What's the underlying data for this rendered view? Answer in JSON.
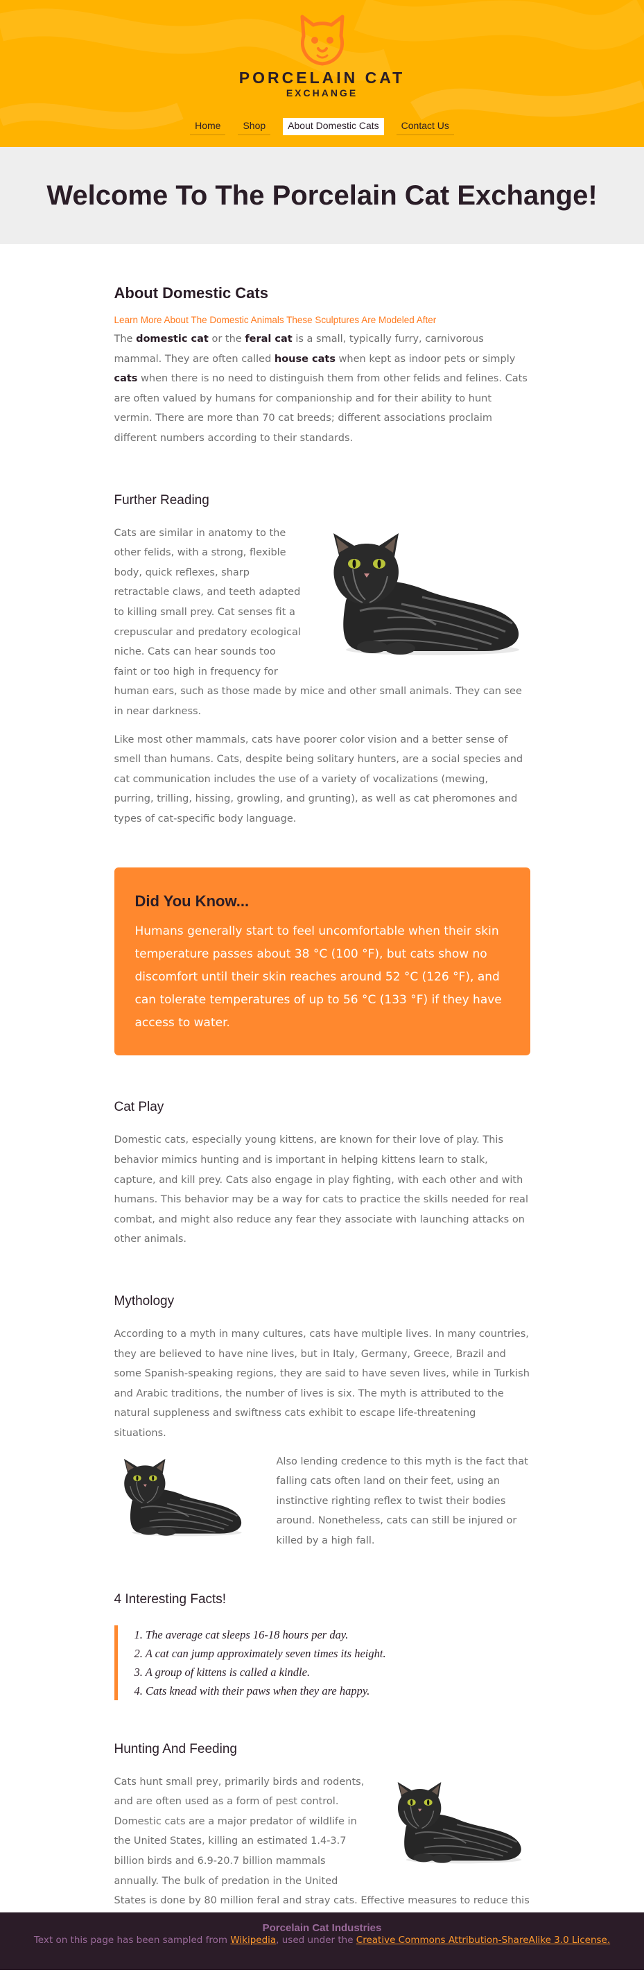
{
  "header": {
    "brand_line1": "PORCELAIN CAT",
    "brand_line2": "EXCHANGE",
    "logo_icon": "cat-face-icon",
    "nav": [
      {
        "label": "Home"
      },
      {
        "label": "Shop"
      },
      {
        "label": "About Domestic Cats",
        "active": true
      },
      {
        "label": "Contact Us"
      }
    ]
  },
  "hero": {
    "title": "Welcome To The Porcelain Cat Exchange!"
  },
  "about": {
    "title": "About Domestic Cats",
    "subtitle": "Learn More About The Domestic Animals These Sculptures Are Modeled After",
    "p1_a": "The ",
    "p1_b1": "domestic cat",
    "p1_c": " or the ",
    "p1_b2": "feral cat",
    "p1_d": " is a small, typically furry, carnivorous mammal. They are often called ",
    "p1_b3": "house cats",
    "p1_e": " when kept as indoor pets or simply ",
    "p1_b4": "cats",
    "p1_f": " when there is no need to distinguish them from other felids and felines. Cats are often valued by humans for companionship and for their ability to hunt vermin. There are more than 70 cat breeds; different associations proclaim different numbers according to their standards."
  },
  "further": {
    "title": "Further Reading",
    "p1": "Cats are similar in anatomy to the other felids, with a strong, flexible body, quick reflexes, sharp retractable claws, and teeth adapted to killing small prey. Cat senses fit a crepuscular and predatory ecological niche. Cats can hear sounds too faint or too high in frequency for human ears, such as those made by mice and other small animals. They can see in near darkness.",
    "p2": "Like most other mammals, cats have poorer color vision and a better sense of smell than humans. Cats, despite being solitary hunters, are a social species and cat communication includes the use of a variety of vocalizations (mewing, purring, trilling, hissing, growling, and grunting), as well as cat pheromones and types of cat-specific body language."
  },
  "did_you_know": {
    "title": "Did You Know...",
    "text": "Humans generally start to feel uncomfortable when their skin temperature passes about 38 °C (100 °F), but cats show no discomfort until their skin reaches around 52 °C (126 °F), and can tolerate temperatures of up to 56 °C (133 °F) if they have access to water."
  },
  "play": {
    "title": "Cat Play",
    "p1": "Domestic cats, especially young kittens, are known for their love of play. This behavior mimics hunting and is important in helping kittens learn to stalk, capture, and kill prey. Cats also engage in play fighting, with each other and with humans. This behavior may be a way for cats to practice the skills needed for real combat, and might also reduce any fear they associate with launching attacks on other animals."
  },
  "mythology": {
    "title": "Mythology",
    "p1": "According to a myth in many cultures, cats have multiple lives. In many countries, they are believed to have nine lives, but in Italy, Germany, Greece, Brazil and some Spanish-speaking regions, they are said to have seven lives, while in Turkish and Arabic traditions, the number of lives is six. The myth is attributed to the natural suppleness and swiftness cats exhibit to escape life-threatening situations.",
    "p2": "Also lending credence to this myth is the fact that falling cats often land on their feet, using an instinctive righting reflex to twist their bodies around. Nonetheless, cats can still be injured or killed by a high fall."
  },
  "facts": {
    "title": "4 Interesting Facts!",
    "items": [
      "1. The average cat sleeps 16-18 hours per day.",
      "2. A cat can jump approximately seven times its height.",
      "3. A group of kittens is called a kindle.",
      "4. Cats knead with their paws when they are happy."
    ]
  },
  "hunting": {
    "title": "Hunting And Feeding",
    "p1": "Cats hunt small prey, primarily birds and rodents, and are often used as a form of pest control. Domestic cats are a major predator of wildlife in the United States, killing an estimated 1.4-3.7 billion birds and 6.9-20.7 billion mammals annually. The bulk of predation in the United States is done by 80 million feral and stray cats. Effective measures to reduce this population are elusive, meeting opposition from cat enthusiasts. In the case of free-ranging pets, equipping cats with bells and not letting them out at night will reduce wildlife predation."
  },
  "footer": {
    "org": "Porcelain Cat Industries",
    "credit_a": "Text on this page has been sampled from ",
    "credit_link1": "Wikipedia",
    "credit_b": ", used under the ",
    "credit_link2": "Creative Commons Attribution-ShareAlike 3.0 License."
  },
  "colors": {
    "header_bg": "#ffb300",
    "accent": "#ff882e",
    "dark": "#2a1d27",
    "footer_bg": "#2b1c28"
  }
}
